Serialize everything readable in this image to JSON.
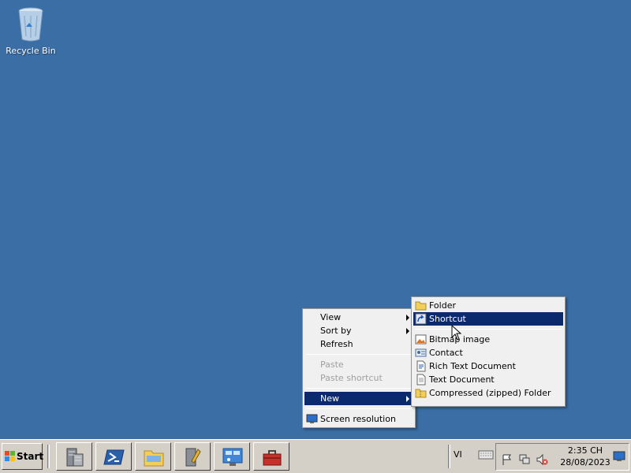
{
  "desktop": {
    "background": "#3a6ea5",
    "icons": [
      {
        "label": "Recycle Bin",
        "icon": "recycle-bin-icon"
      }
    ]
  },
  "context_menu": {
    "items": [
      {
        "label": "View",
        "submenu": true
      },
      {
        "label": "Sort by",
        "submenu": true
      },
      {
        "label": "Refresh"
      },
      {
        "label": "Paste",
        "disabled": true
      },
      {
        "label": "Paste shortcut",
        "disabled": true
      },
      {
        "label": "New",
        "submenu": true,
        "highlighted": true
      },
      {
        "label": "Screen resolution",
        "icon": "screen-resolution-icon"
      }
    ]
  },
  "new_submenu": {
    "items": [
      {
        "label": "Folder",
        "icon": "folder-icon"
      },
      {
        "label": "Shortcut",
        "icon": "shortcut-icon",
        "highlighted": true
      },
      {
        "label": "Bitmap image",
        "icon": "bitmap-icon"
      },
      {
        "label": "Contact",
        "icon": "contact-icon"
      },
      {
        "label": "Rich Text Document",
        "icon": "rich-text-icon"
      },
      {
        "label": "Text Document",
        "icon": "text-document-icon"
      },
      {
        "label": "Compressed (zipped) Folder",
        "icon": "zip-folder-icon"
      }
    ]
  },
  "taskbar": {
    "start_label": "Start",
    "pinned": [
      {
        "icon": "server-manager-icon"
      },
      {
        "icon": "powershell-icon"
      },
      {
        "icon": "file-explorer-icon"
      },
      {
        "icon": "admin-tools-icon"
      },
      {
        "icon": "control-panel-icon"
      },
      {
        "icon": "toolbox-icon"
      }
    ],
    "language": "VI",
    "clock_time": "2:35 CH",
    "clock_date": "28/08/2023"
  },
  "colors": {
    "menu_highlight": "#0b2a6e",
    "taskbar": "#d4d0c8"
  }
}
